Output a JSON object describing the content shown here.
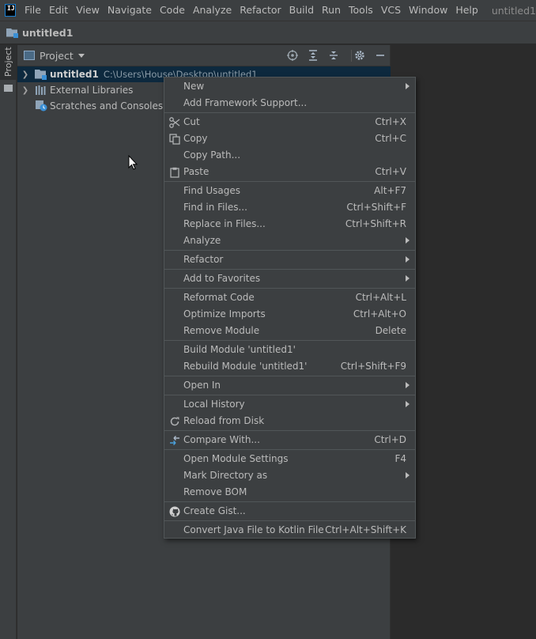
{
  "menubar": {
    "logo": "IJ",
    "items": [
      "File",
      "Edit",
      "View",
      "Navigate",
      "Code",
      "Analyze",
      "Refactor",
      "Build",
      "Run",
      "Tools",
      "VCS",
      "Window",
      "Help"
    ],
    "window_title": "untitled1"
  },
  "navbar": {
    "title": "untitled1"
  },
  "left_strip": {
    "tab_label": "Project"
  },
  "project_panel": {
    "title": "Project",
    "tree": [
      {
        "label": "untitled1",
        "path": "C:\\Users\\House\\Desktop\\untitled1",
        "selected": true
      },
      {
        "label": "External Libraries"
      },
      {
        "label": "Scratches and Consoles"
      }
    ]
  },
  "context_menu": {
    "items": [
      {
        "label": "New",
        "submenu": true
      },
      {
        "label": "Add Framework Support..."
      },
      {
        "sep": true
      },
      {
        "label": "Cut",
        "shortcut": "Ctrl+X",
        "icon": "scissors-icon"
      },
      {
        "label": "Copy",
        "shortcut": "Ctrl+C",
        "icon": "copy-icon"
      },
      {
        "label": "Copy Path..."
      },
      {
        "label": "Paste",
        "shortcut": "Ctrl+V",
        "icon": "clipboard-icon"
      },
      {
        "sep": true
      },
      {
        "label": "Find Usages",
        "shortcut": "Alt+F7"
      },
      {
        "label": "Find in Files...",
        "shortcut": "Ctrl+Shift+F"
      },
      {
        "label": "Replace in Files...",
        "shortcut": "Ctrl+Shift+R"
      },
      {
        "label": "Analyze",
        "submenu": true
      },
      {
        "sep": true
      },
      {
        "label": "Refactor",
        "submenu": true
      },
      {
        "sep": true
      },
      {
        "label": "Add to Favorites",
        "submenu": true
      },
      {
        "sep": true
      },
      {
        "label": "Reformat Code",
        "shortcut": "Ctrl+Alt+L"
      },
      {
        "label": "Optimize Imports",
        "shortcut": "Ctrl+Alt+O"
      },
      {
        "label": "Remove Module",
        "shortcut": "Delete"
      },
      {
        "sep": true
      },
      {
        "label": "Build Module 'untitled1'"
      },
      {
        "label": "Rebuild Module 'untitled1'",
        "shortcut": "Ctrl+Shift+F9"
      },
      {
        "sep": true
      },
      {
        "label": "Open In",
        "submenu": true
      },
      {
        "sep": true
      },
      {
        "label": "Local History",
        "submenu": true
      },
      {
        "label": "Reload from Disk",
        "icon": "reload-icon"
      },
      {
        "sep": true
      },
      {
        "label": "Compare With...",
        "shortcut": "Ctrl+D",
        "icon": "compare-icon"
      },
      {
        "sep": true
      },
      {
        "label": "Open Module Settings",
        "shortcut": "F4"
      },
      {
        "label": "Mark Directory as",
        "submenu": true
      },
      {
        "label": "Remove BOM"
      },
      {
        "sep": true
      },
      {
        "label": "Create Gist...",
        "icon": "github-icon"
      },
      {
        "sep": true
      },
      {
        "label": "Convert Java File to Kotlin File",
        "shortcut": "Ctrl+Alt+Shift+K"
      }
    ]
  }
}
